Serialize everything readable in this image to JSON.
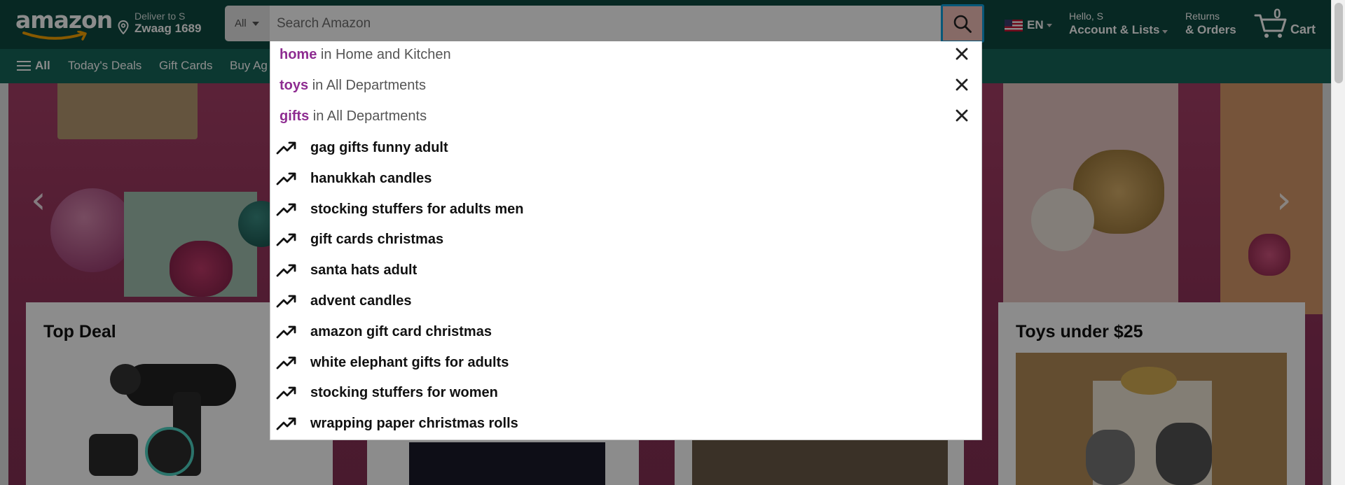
{
  "header": {
    "logo_text": "amazon",
    "deliver_line1": "Deliver to S",
    "deliver_line2": "Zwaag 1689",
    "search_category": "All",
    "search_placeholder": "Search Amazon",
    "search_value": "",
    "language": "EN",
    "account_line1": "Hello, S",
    "account_line2": "Account & Lists",
    "returns_line1": "Returns",
    "returns_line2": "& Orders",
    "cart_count": "0",
    "cart_label": "Cart"
  },
  "subnav": {
    "all_label": "All",
    "items": [
      "Today's Deals",
      "Gift Cards",
      "Buy Ag"
    ]
  },
  "suggestions": {
    "recent": [
      {
        "keyword": "home",
        "department": "in Home and Kitchen"
      },
      {
        "keyword": "toys",
        "department": "in All Departments"
      },
      {
        "keyword": "gifts",
        "department": "in All Departments"
      }
    ],
    "trending": [
      "gag gifts funny adult",
      "hanukkah candles",
      "stocking stuffers for adults men",
      "gift cards christmas",
      "santa hats adult",
      "advent candles",
      "amazon gift card christmas",
      "white elephant gifts for adults",
      "stocking stuffers for women",
      "wrapping paper christmas rolls"
    ]
  },
  "cards": {
    "left_title": "Top Deal",
    "right_title": "Toys under $25"
  },
  "icons": {
    "search": "search-icon",
    "location": "location-pin-icon",
    "cart": "cart-icon",
    "trending": "trending-up-icon",
    "remove": "close-icon",
    "menu": "hamburger-icon",
    "flag": "us-flag-icon"
  },
  "colors": {
    "nav_top": "#0e4a40",
    "nav_sub": "#16665a",
    "search_button": "#f4c1ba",
    "search_focus": "#0fa0dc",
    "recent_keyword": "#8e2c91",
    "hero": "#9b3b63"
  }
}
